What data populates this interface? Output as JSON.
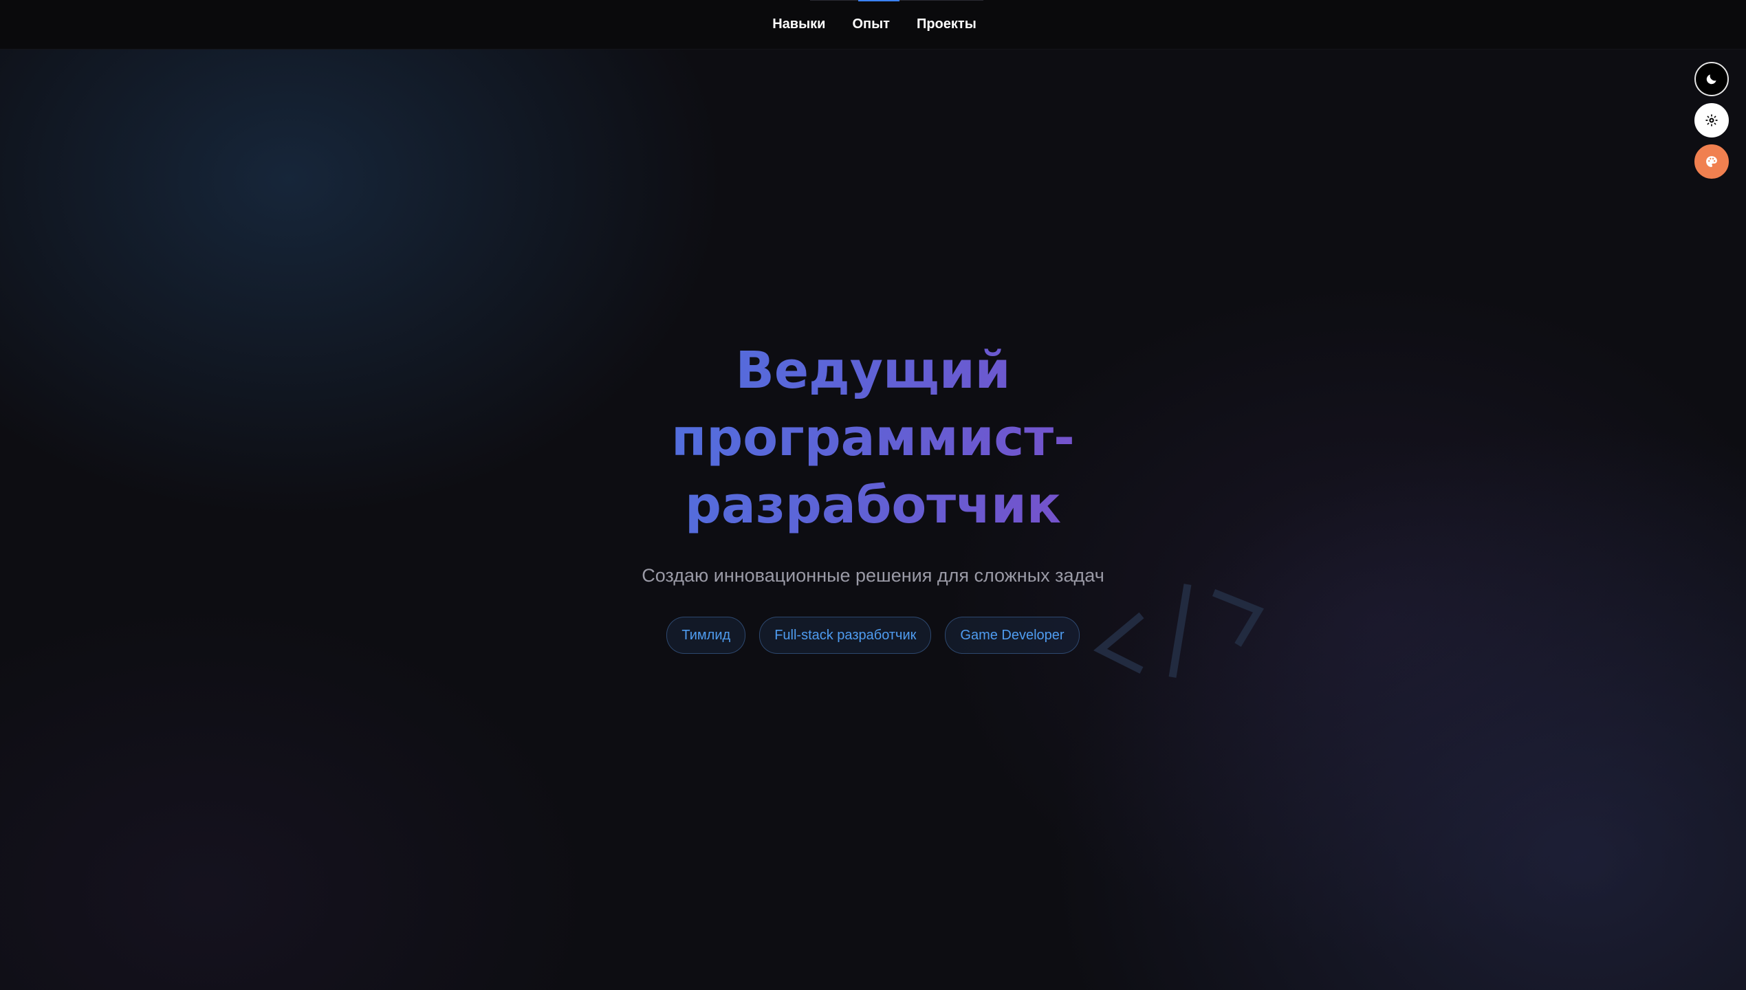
{
  "nav": {
    "items": [
      {
        "label": "Навыки"
      },
      {
        "label": "Опыт"
      },
      {
        "label": "Проекты"
      }
    ]
  },
  "side_buttons": [
    {
      "icon": "moon-icon",
      "color": "#000000"
    },
    {
      "icon": "sun-gear-icon",
      "color": "#ffffff"
    },
    {
      "icon": "palette-icon",
      "color": "#f08050"
    }
  ],
  "hero": {
    "title": "Ведущий программист-разработчик",
    "subtitle": "Создаю инновационные решения для сложных задач",
    "tags": [
      {
        "label": "Тимлид"
      },
      {
        "label": "Full-stack разработчик"
      },
      {
        "label": "Game Developer"
      }
    ]
  },
  "decoration": {
    "icon": "code-brackets-icon"
  },
  "colors": {
    "accent": "#4f9cf0",
    "title_gradient_start": "#4f72e0",
    "title_gradient_end": "#7a4fc9",
    "background": "#0d0d12"
  }
}
